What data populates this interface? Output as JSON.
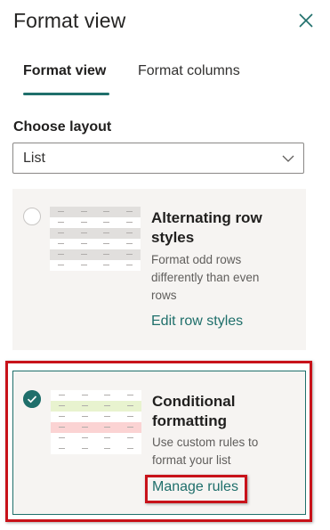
{
  "panel": {
    "title": "Format view",
    "close_icon": "close-icon"
  },
  "tabs": [
    {
      "label": "Format view",
      "active": true
    },
    {
      "label": "Format columns",
      "active": false
    }
  ],
  "layout": {
    "label": "Choose layout",
    "selected": "List",
    "chevron_icon": "chevron-down-icon"
  },
  "options": [
    {
      "title": "Alternating row styles",
      "description": "Format odd rows differently than even rows",
      "link": "Edit row styles",
      "selected": false
    },
    {
      "title": "Conditional formatting",
      "description": "Use custom rules to format your list",
      "link": "Manage rules",
      "selected": true
    }
  ],
  "colors": {
    "accent": "#1f6f6b",
    "highlight_annotation": "#c8121a",
    "alt_row_gray": "#e1dfdd",
    "cond_green": "#e8f3cf",
    "cond_red": "#fbd3d3"
  }
}
